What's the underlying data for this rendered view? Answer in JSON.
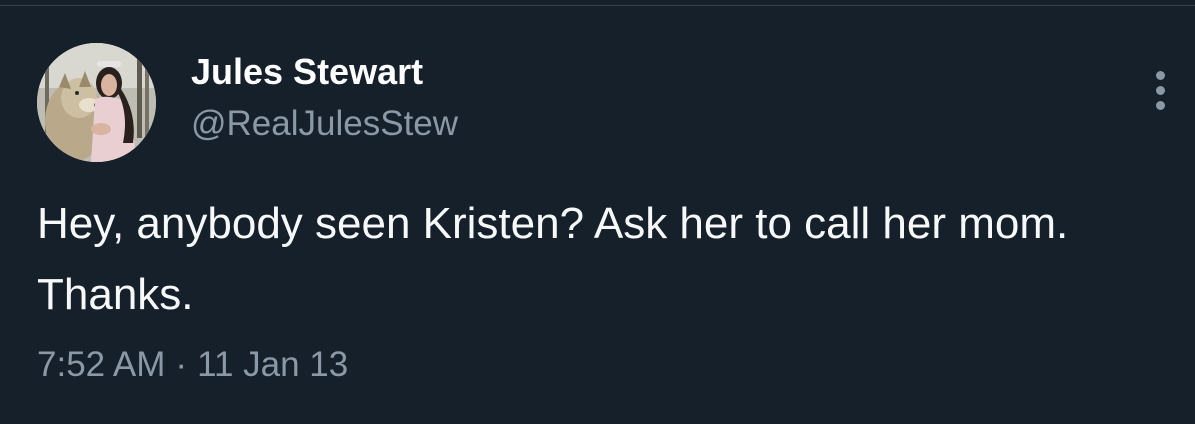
{
  "author": {
    "display_name": "Jules Stewart",
    "handle": "@RealJulesStew",
    "avatar_alt": "profile photo"
  },
  "tweet": {
    "text": "Hey, anybody seen Kristen? Ask her to call her mom. Thanks.",
    "time": "7:52 AM",
    "separator": "·",
    "date": "11 Jan 13"
  },
  "icons": {
    "more": "more-vertical-icon"
  },
  "colors": {
    "background": "#15202b",
    "primary_text": "#f7f9f9",
    "secondary_text": "#8b98a5",
    "divider": "#38444d"
  }
}
